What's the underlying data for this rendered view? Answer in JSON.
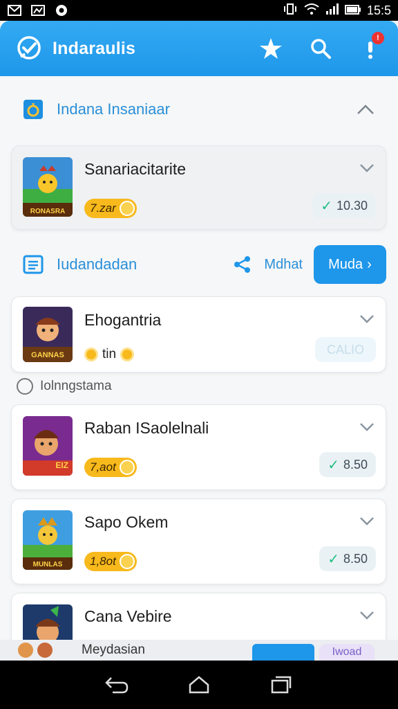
{
  "status_bar": {
    "time": "15:5"
  },
  "app_bar": {
    "title": "Indaraulis"
  },
  "section1": {
    "title": "Indana Insaniaar"
  },
  "cards": [
    {
      "name": "Sanariacitarite",
      "price": "7.zar",
      "rating": "10.30",
      "thumb_caption": "RONASRA"
    },
    {
      "name": "Ehogantria",
      "price": "tin",
      "rating": "CALIO",
      "thumb_caption": "GANNAS"
    },
    {
      "name": "Raban ISaolelnali",
      "price": "7,aot",
      "rating": "8.50",
      "thumb_caption": "EIZ"
    },
    {
      "name": "Sapo Okem",
      "price": "1,8ot",
      "rating": "8.50",
      "thumb_caption": "MUNLAS"
    },
    {
      "name": "Cana Vebire"
    }
  ],
  "section2": {
    "title": "Iudandadan",
    "share_label": "Mdhat",
    "more_button": "Muda"
  },
  "sub_label": "Iolnngstama",
  "bottom_strip": {
    "text": "Meydasian",
    "pill": "Iwoad"
  },
  "colors": {
    "primary": "#1e96ea",
    "accent_gold": "#f7b91c",
    "check_green": "#1fbf83"
  }
}
